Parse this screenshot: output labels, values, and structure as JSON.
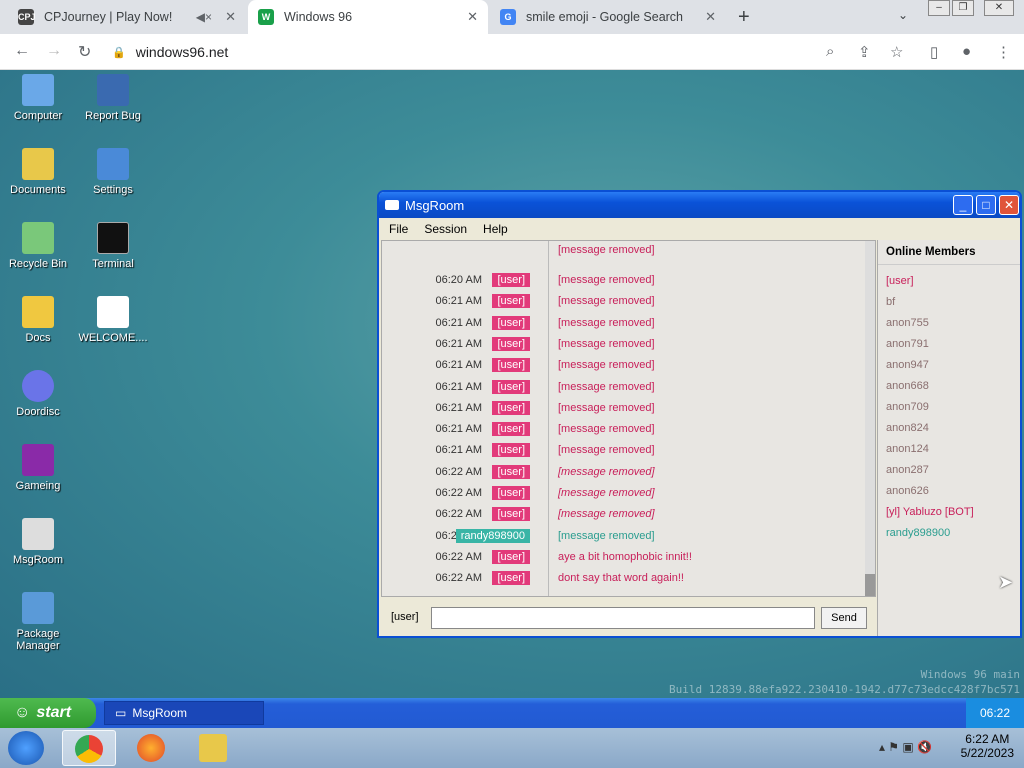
{
  "browser": {
    "tabs": [
      {
        "title": "CPJourney | Play Now!",
        "fav": "CPJ",
        "favcolor": "#444"
      },
      {
        "title": "Windows 96",
        "fav": "W",
        "favcolor": "#1aa04a"
      },
      {
        "title": "smile emoji - Google Search",
        "fav": "G",
        "favcolor": "#4285f4"
      }
    ],
    "url": "windows96.net"
  },
  "desktop_icons": [
    {
      "label": "Computer"
    },
    {
      "label": "Report Bug"
    },
    {
      "label": "Documents"
    },
    {
      "label": "Settings"
    },
    {
      "label": "Recycle Bin"
    },
    {
      "label": "Terminal"
    },
    {
      "label": "Docs"
    },
    {
      "label": "WELCOME...."
    },
    {
      "label": "Doordisc"
    },
    {
      "label": "Gameing"
    },
    {
      "label": "MsgRoom"
    },
    {
      "label": "Package Manager"
    }
  ],
  "window": {
    "title": "MsgRoom",
    "menu": [
      "File",
      "Session",
      "Help"
    ],
    "top_line": "[message removed]",
    "messages": [
      {
        "time": "06:20 AM",
        "nick": "[user]",
        "text": "[message removed]"
      },
      {
        "time": "06:21 AM",
        "nick": "[user]",
        "text": "[message removed]"
      },
      {
        "time": "06:21 AM",
        "nick": "[user]",
        "text": "[message removed]"
      },
      {
        "time": "06:21 AM",
        "nick": "[user]",
        "text": "[message removed]"
      },
      {
        "time": "06:21 AM",
        "nick": "[user]",
        "text": "[message removed]"
      },
      {
        "time": "06:21 AM",
        "nick": "[user]",
        "text": "[message removed]"
      },
      {
        "time": "06:21 AM",
        "nick": "[user]",
        "text": "[message removed]"
      },
      {
        "time": "06:21 AM",
        "nick": "[user]",
        "text": "[message removed]"
      },
      {
        "time": "06:21 AM",
        "nick": "[user]",
        "text": "[message removed]"
      },
      {
        "time": "06:22 AM",
        "nick": "[user]",
        "text": "[message removed]"
      },
      {
        "time": "06:22 AM",
        "nick": "[user]",
        "text": "[message removed]"
      },
      {
        "time": "06:22 AM",
        "nick": "[user]",
        "text": "[message removed]"
      },
      {
        "time": "06:22 AM",
        "nick": "randy898900",
        "text": "[message removed]"
      },
      {
        "time": "06:22 AM",
        "nick": "[user]",
        "text": "aye a bit homophobic innit!!"
      },
      {
        "time": "06:22 AM",
        "nick": "[user]",
        "text": "dont say that word again!!"
      }
    ],
    "members_title": "Online Members",
    "members": [
      "[user]",
      "bf",
      "anon755",
      "anon791",
      "anon947",
      "anon668",
      "anon709",
      "anon824",
      "anon124",
      "anon287",
      "anon626",
      "[yl] Yabluzo [BOT]",
      "randy898900"
    ],
    "input_label": "[user]",
    "send_label": "Send"
  },
  "watermark": {
    "line1": "Windows 96 main",
    "line2": "Build 12839.88efa922.230410-1942.d77c73edcc428f7bc571"
  },
  "taskbar96": {
    "start": "start",
    "item": "MsgRoom",
    "clock": "06:22"
  },
  "taskbar7": {
    "time": "6:22 AM",
    "date": "5/22/2023"
  }
}
